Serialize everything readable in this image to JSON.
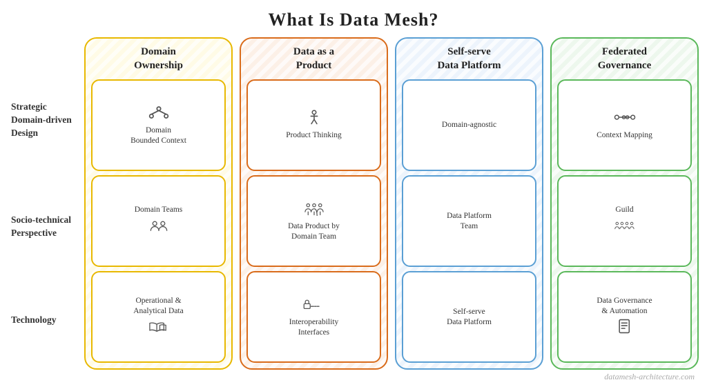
{
  "title": "What Is Data Mesh?",
  "watermark": "datamesh-architecture.com",
  "row_labels": [
    {
      "id": "strategic",
      "text": "Strategic\nDomain-driven\nDesign"
    },
    {
      "id": "socio",
      "text": "Socio-technical\nPerspective"
    },
    {
      "id": "tech",
      "text": "Technology"
    }
  ],
  "columns": [
    {
      "id": "domain-ownership",
      "header": "Domain\nOwnership",
      "color": "yellow",
      "cards": [
        {
          "id": "domain-bounded-context",
          "label": "Domain\nBounded Context",
          "icon": "network"
        },
        {
          "id": "domain-teams",
          "label": "Domain Teams",
          "icon": "people"
        },
        {
          "id": "operational-analytical",
          "label": "Operational &\nAnalytical Data",
          "icon": "book"
        }
      ]
    },
    {
      "id": "data-as-product",
      "header": "Data as a\nProduct",
      "color": "orange",
      "cards": [
        {
          "id": "product-thinking",
          "label": "Product Thinking",
          "icon": "flask"
        },
        {
          "id": "data-product-domain-team",
          "label": "Data Product by\nDomain Team",
          "icon": "team-data"
        },
        {
          "id": "interoperability-interfaces",
          "label": "Interoperability\nInterfaces",
          "icon": "lock-plug"
        }
      ]
    },
    {
      "id": "self-serve-platform",
      "header": "Self-serve\nData Platform",
      "color": "blue",
      "cards": [
        {
          "id": "domain-agnostic",
          "label": "Domain-agnostic",
          "icon": "none"
        },
        {
          "id": "data-platform-team",
          "label": "Data Platform\nTeam",
          "icon": "none"
        },
        {
          "id": "self-serve-data-platform",
          "label": "Self-serve\nData Platform",
          "icon": "none"
        }
      ]
    },
    {
      "id": "federated-governance",
      "header": "Federated\nGovernance",
      "color": "green",
      "cards": [
        {
          "id": "context-mapping",
          "label": "Context Mapping",
          "icon": "context-map"
        },
        {
          "id": "guild",
          "label": "Guild",
          "icon": "guild-people"
        },
        {
          "id": "data-governance-automation",
          "label": "Data Governance\n& Automation",
          "icon": "document"
        }
      ]
    }
  ]
}
